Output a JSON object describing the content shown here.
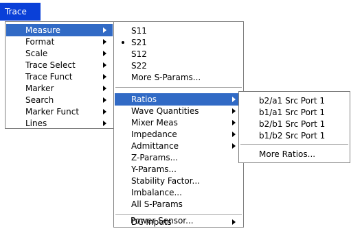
{
  "menubar": {
    "trace_label": "Trace"
  },
  "colors": {
    "highlight": "#316ac5",
    "menubar_active": "#0a40d8",
    "menu_border": "#7f7f7f",
    "menu_background": "#ffffff"
  },
  "trace_menu": {
    "items": [
      {
        "label": "Measure",
        "has_submenu": true,
        "highlighted": true
      },
      {
        "label": "Format",
        "has_submenu": true
      },
      {
        "label": "Scale",
        "has_submenu": true
      },
      {
        "label": "Trace Select",
        "has_submenu": true
      },
      {
        "label": "Trace Funct",
        "has_submenu": true
      },
      {
        "label": "Marker",
        "has_submenu": true
      },
      {
        "label": "Search",
        "has_submenu": true
      },
      {
        "label": "Marker Funct",
        "has_submenu": true
      },
      {
        "label": "Lines",
        "has_submenu": true
      }
    ]
  },
  "measure_menu": {
    "items": [
      {
        "label": "S11"
      },
      {
        "label": "S21",
        "checked": true
      },
      {
        "label": "S12"
      },
      {
        "label": "S22"
      },
      {
        "label": "More S-Params..."
      },
      {
        "label": "Ratios",
        "has_submenu": true,
        "highlighted": true
      },
      {
        "label": "Wave Quantities",
        "has_submenu": true
      },
      {
        "label": "Mixer Meas",
        "has_submenu": true
      },
      {
        "label": "Impedance",
        "has_submenu": true
      },
      {
        "label": "Admittance",
        "has_submenu": true
      },
      {
        "label": "Z-Params..."
      },
      {
        "label": "Y-Params..."
      },
      {
        "label": "Stability Factor..."
      },
      {
        "label": "Imbalance..."
      },
      {
        "label": "All S-Params"
      },
      {
        "label": "DC Inputs",
        "has_submenu": true
      },
      {
        "label": "Power Sensor..."
      }
    ]
  },
  "ratios_menu": {
    "items": [
      {
        "label": "b2/a1 Src Port 1"
      },
      {
        "label": "b1/a1 Src Port 1"
      },
      {
        "label": "b2/b1 Src Port 1"
      },
      {
        "label": "b1/b2 Src Port 1"
      },
      {
        "label": "More Ratios..."
      }
    ]
  }
}
